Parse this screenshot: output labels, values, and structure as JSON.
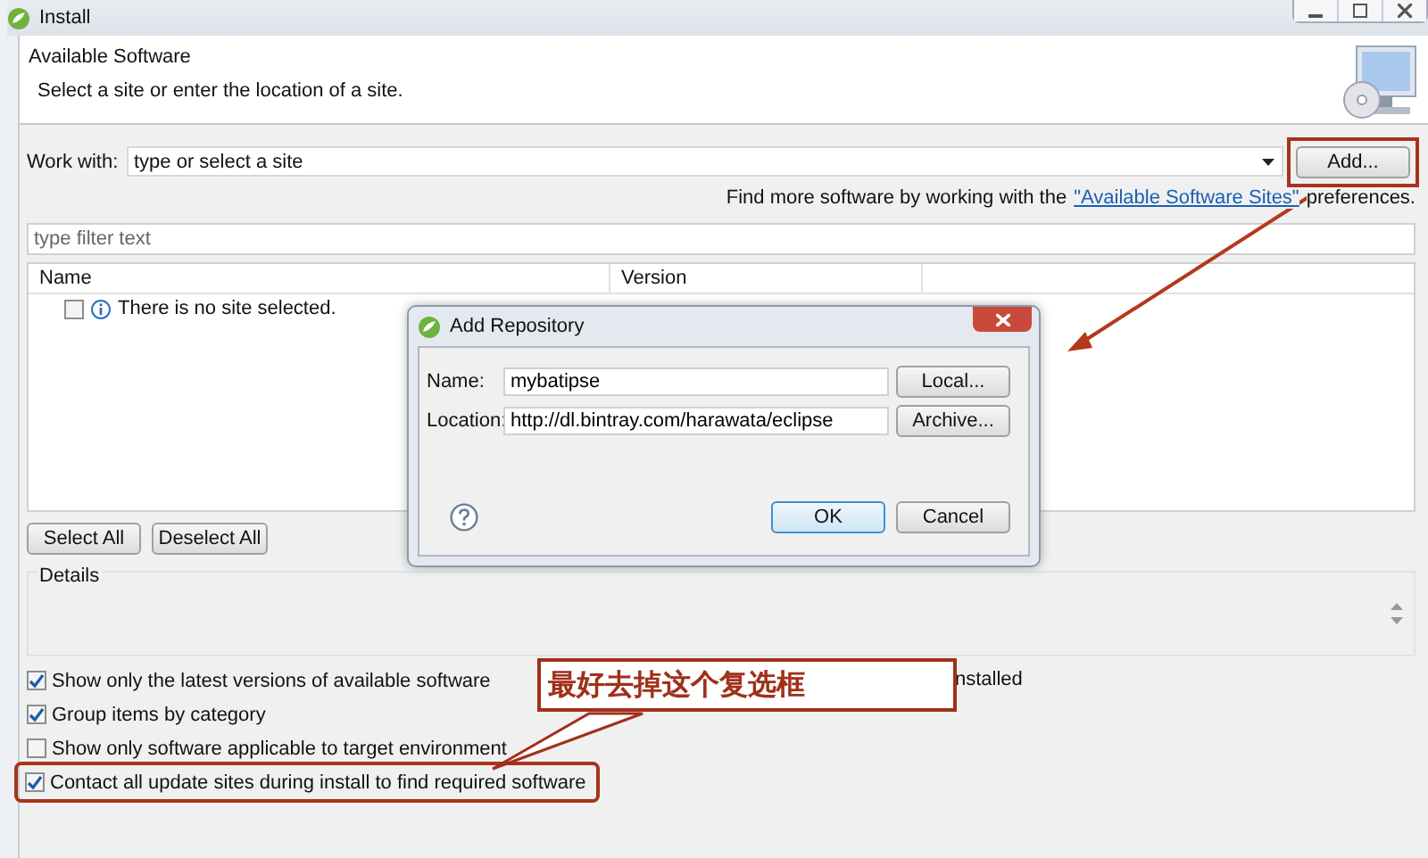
{
  "window": {
    "title": "Install"
  },
  "header": {
    "title": "Available Software",
    "subtitle": "Select a site or enter the location of a site."
  },
  "work_with": {
    "label": "Work with:",
    "placeholder": "type or select a site",
    "add_button": "Add...",
    "highlighted": true
  },
  "more_software": {
    "text_before": "Find more software by working with the",
    "link": "\"Available Software Sites\"",
    "text_after": "preferences."
  },
  "filter": {
    "placeholder": "type filter text"
  },
  "table": {
    "columns": [
      "Name",
      "Version"
    ],
    "rows": [
      {
        "name": "There is no site selected.",
        "checked": false
      }
    ]
  },
  "buttons": [
    "Select All",
    "Deselect All"
  ],
  "details": {
    "label": "Details"
  },
  "options": [
    {
      "label": "Show only the latest versions of available software",
      "checked": true,
      "highlighted": false
    },
    {
      "label": "Group items by category",
      "checked": true,
      "highlighted": false
    },
    {
      "label": "Show only software applicable to target environment",
      "checked": false,
      "highlighted": false
    },
    {
      "label": "Contact all update sites during install to find required software",
      "checked": true,
      "highlighted": true
    }
  ],
  "right_option": {
    "label": "nstalled"
  },
  "add_repository": {
    "title": "Add Repository",
    "fields": [
      {
        "label": "Name:",
        "value": "mybatipse",
        "button": "Local..."
      },
      {
        "label": "Location:",
        "value": "http://dl.bintray.com/harawata/eclipse",
        "button": "Archive..."
      }
    ],
    "buttons": [
      {
        "label": "OK",
        "default": true
      },
      {
        "label": "Cancel",
        "default": false
      }
    ]
  },
  "annotation": {
    "callout": "最好去掉这个复选框"
  }
}
